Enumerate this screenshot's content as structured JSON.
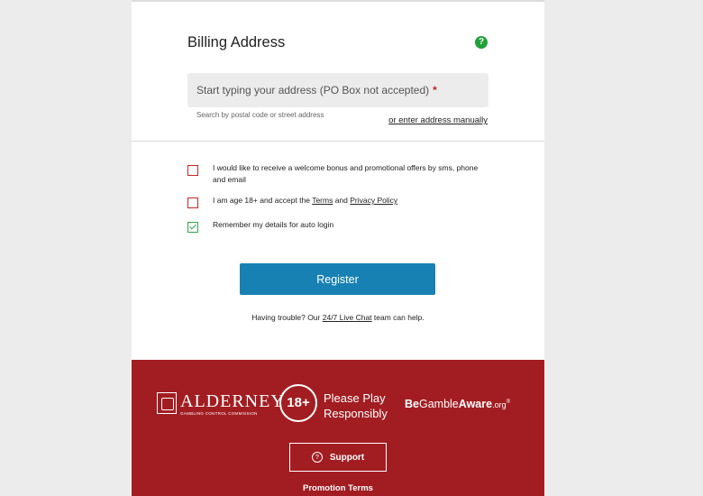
{
  "billing": {
    "title": "Billing Address",
    "help_icon": "question-mark-icon",
    "address_placeholder": "Start typing your address (PO Box not accepted)",
    "required_marker": "*",
    "hint": "Search by postal code or street address",
    "manual_link": "or enter address manually"
  },
  "checkboxes": [
    {
      "label": "I would like to receive a welcome bonus and promotional offers by sms, phone and email",
      "checked": false
    },
    {
      "label_prefix": "I am age 18+ and accept the ",
      "terms": "Terms",
      "and": " and ",
      "privacy": "Privacy Policy",
      "checked": false
    },
    {
      "label": "Remember my details for auto login",
      "checked": true
    }
  ],
  "register_label": "Register",
  "trouble": {
    "prefix": "Having trouble? Our ",
    "link": "24/7 Live Chat",
    "suffix": " team can help."
  },
  "footer": {
    "alderney_main": "ALDERNEY",
    "alderney_sub": "GAMBLING CONTROL COMMISSION",
    "age_badge": "18+",
    "please_play_1": "Please Play",
    "please_play_2": "Responsibly",
    "begamble_be": "Be",
    "begamble_gamble": "Gamble",
    "begamble_aware": "Aware",
    "begamble_org": ".org",
    "begamble_reg": "®",
    "support_icon_glyph": "?",
    "support_label": "Support",
    "promotion_terms": "Promotion Terms"
  },
  "colors": {
    "accent_blue": "#1781b3",
    "footer_red": "#a21d21",
    "help_green": "#22a03a",
    "error_red": "#c72626",
    "success_green": "#2fa84a"
  }
}
